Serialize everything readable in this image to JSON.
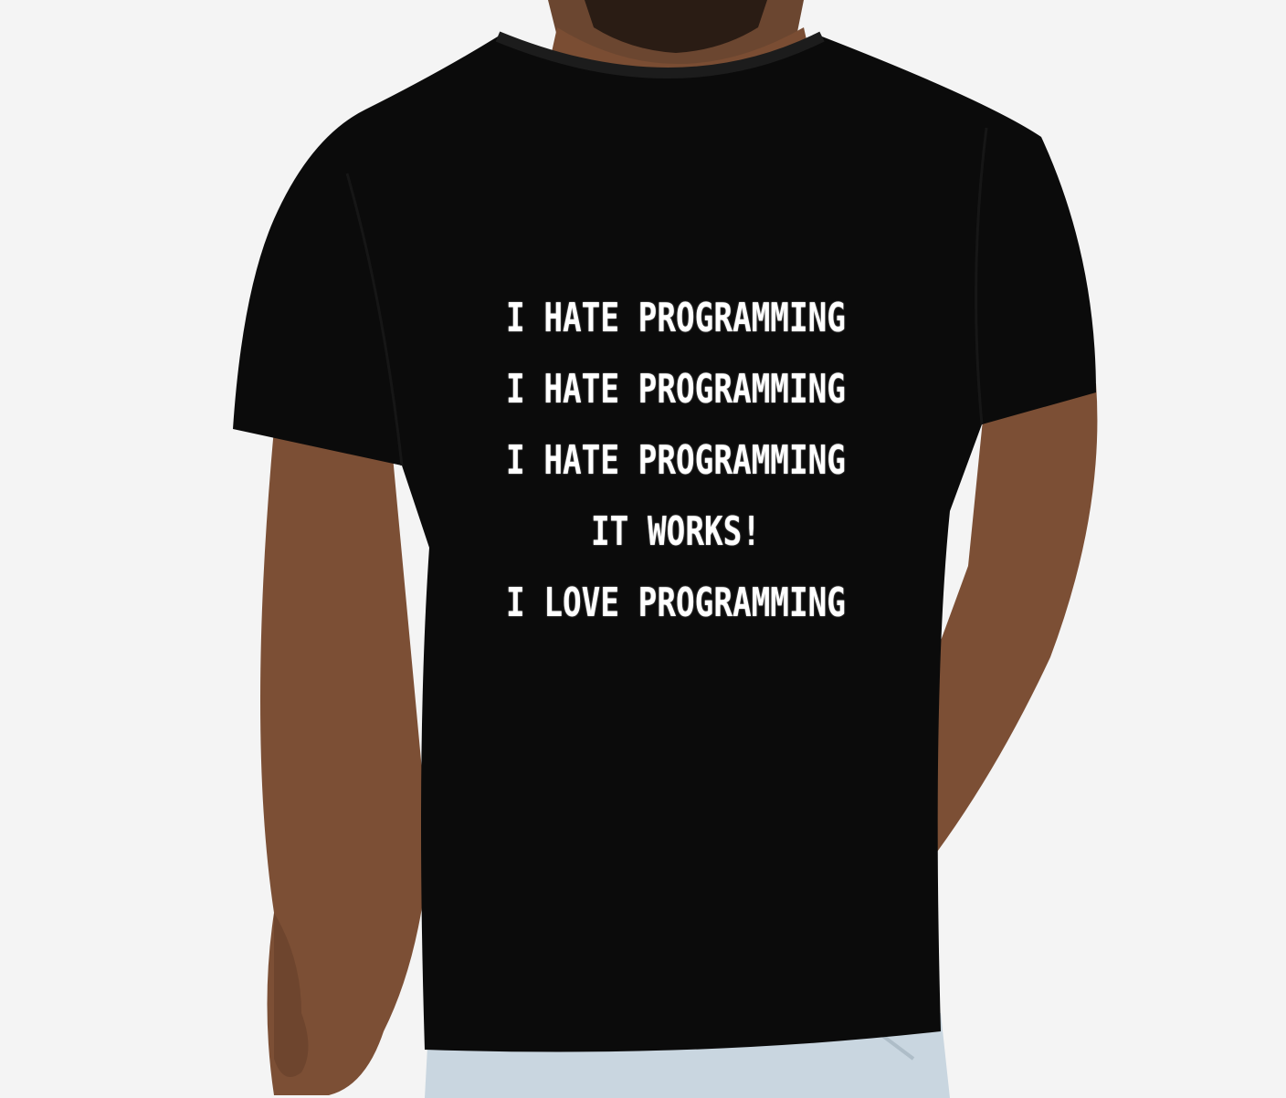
{
  "shirt_print": {
    "lines": [
      "I HATE PROGRAMMING",
      "I HATE PROGRAMMING",
      "I HATE PROGRAMMING",
      "IT WORKS!",
      "I LOVE PROGRAMMING"
    ]
  },
  "colors": {
    "background": "#f4f4f4",
    "shirt": "#0b0b0b",
    "print": "#ffffff",
    "skin": "#8a5a3c",
    "jeans": "#c9d6e0"
  }
}
